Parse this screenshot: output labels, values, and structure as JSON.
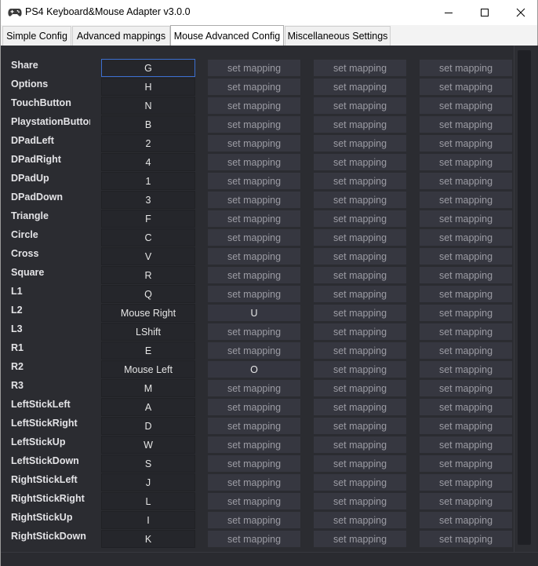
{
  "window": {
    "title": "PS4 Keyboard&Mouse Adapter v3.0.0"
  },
  "tabs": [
    {
      "label": "Simple Config",
      "active": false
    },
    {
      "label": "Advanced mappings",
      "active": false
    },
    {
      "label": "Mouse Advanced Config",
      "active": true
    },
    {
      "label": "Miscellaneous Settings",
      "active": false
    }
  ],
  "placeholder": "set mapping",
  "rows": [
    {
      "label": "Share",
      "cells": [
        "G",
        "set mapping",
        "set mapping",
        "set mapping"
      ]
    },
    {
      "label": "Options",
      "cells": [
        "H",
        "set mapping",
        "set mapping",
        "set mapping"
      ]
    },
    {
      "label": "TouchButton",
      "cells": [
        "N",
        "set mapping",
        "set mapping",
        "set mapping"
      ]
    },
    {
      "label": "PlaystationButton",
      "cells": [
        "B",
        "set mapping",
        "set mapping",
        "set mapping"
      ]
    },
    {
      "label": "DPadLeft",
      "cells": [
        "2",
        "set mapping",
        "set mapping",
        "set mapping"
      ]
    },
    {
      "label": "DPadRight",
      "cells": [
        "4",
        "set mapping",
        "set mapping",
        "set mapping"
      ]
    },
    {
      "label": "DPadUp",
      "cells": [
        "1",
        "set mapping",
        "set mapping",
        "set mapping"
      ]
    },
    {
      "label": "DPadDown",
      "cells": [
        "3",
        "set mapping",
        "set mapping",
        "set mapping"
      ]
    },
    {
      "label": "Triangle",
      "cells": [
        "F",
        "set mapping",
        "set mapping",
        "set mapping"
      ]
    },
    {
      "label": "Circle",
      "cells": [
        "C",
        "set mapping",
        "set mapping",
        "set mapping"
      ]
    },
    {
      "label": "Cross",
      "cells": [
        "V",
        "set mapping",
        "set mapping",
        "set mapping"
      ]
    },
    {
      "label": "Square",
      "cells": [
        "R",
        "set mapping",
        "set mapping",
        "set mapping"
      ]
    },
    {
      "label": "L1",
      "cells": [
        "Q",
        "set mapping",
        "set mapping",
        "set mapping"
      ]
    },
    {
      "label": "L2",
      "cells": [
        "Mouse Right",
        "U",
        "set mapping",
        "set mapping"
      ]
    },
    {
      "label": "L3",
      "cells": [
        "LShift",
        "set mapping",
        "set mapping",
        "set mapping"
      ]
    },
    {
      "label": "R1",
      "cells": [
        "E",
        "set mapping",
        "set mapping",
        "set mapping"
      ]
    },
    {
      "label": "R2",
      "cells": [
        "Mouse Left",
        "O",
        "set mapping",
        "set mapping"
      ]
    },
    {
      "label": "R3",
      "cells": [
        "M",
        "set mapping",
        "set mapping",
        "set mapping"
      ]
    },
    {
      "label": "LeftStickLeft",
      "cells": [
        "A",
        "set mapping",
        "set mapping",
        "set mapping"
      ]
    },
    {
      "label": "LeftStickRight",
      "cells": [
        "D",
        "set mapping",
        "set mapping",
        "set mapping"
      ]
    },
    {
      "label": "LeftStickUp",
      "cells": [
        "W",
        "set mapping",
        "set mapping",
        "set mapping"
      ]
    },
    {
      "label": "LeftStickDown",
      "cells": [
        "S",
        "set mapping",
        "set mapping",
        "set mapping"
      ]
    },
    {
      "label": "RightStickLeft",
      "cells": [
        "J",
        "set mapping",
        "set mapping",
        "set mapping"
      ]
    },
    {
      "label": "RightStickRight",
      "cells": [
        "L",
        "set mapping",
        "set mapping",
        "set mapping"
      ]
    },
    {
      "label": "RightStickUp",
      "cells": [
        "I",
        "set mapping",
        "set mapping",
        "set mapping"
      ]
    },
    {
      "label": "RightStickDown",
      "cells": [
        "K",
        "set mapping",
        "set mapping",
        "set mapping"
      ]
    }
  ],
  "selected_cell": {
    "row": 0,
    "col": 0
  },
  "colors": {
    "background": "#2b2c31",
    "mapped_cell": "#25262b",
    "empty_cell": "#363740",
    "selection_border": "#3c6fd0"
  }
}
